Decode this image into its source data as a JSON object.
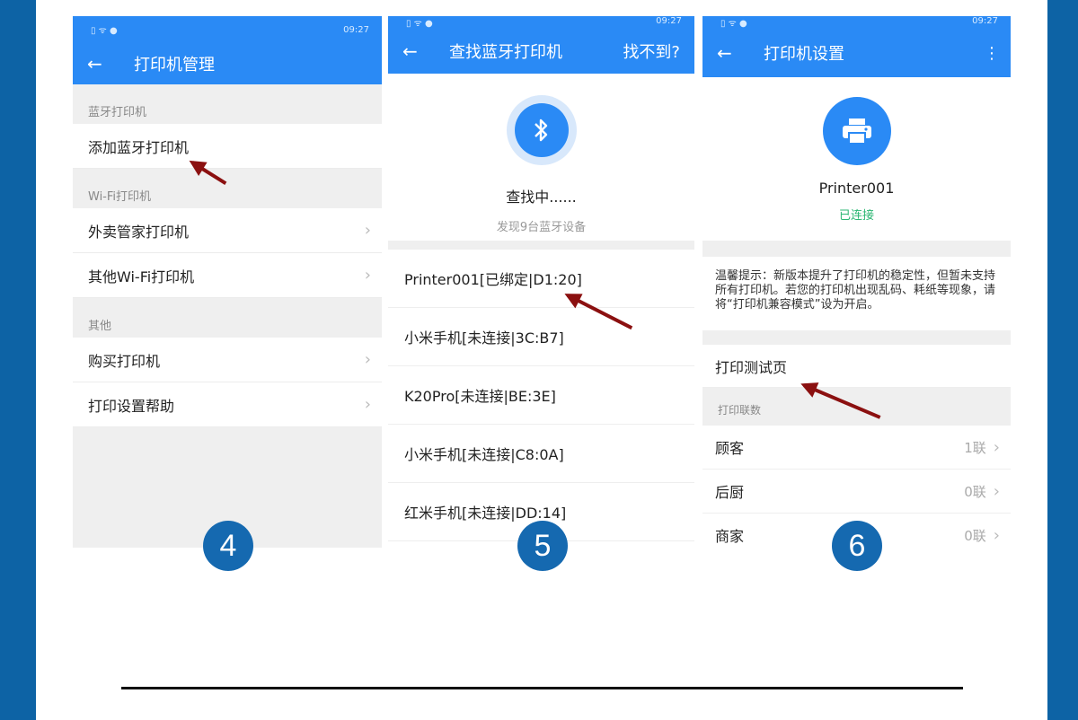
{
  "colors": {
    "accent": "#2a8af5",
    "frame": "#0d63a5",
    "arrow": "#8b1010",
    "badge": "#1569b0",
    "connected": "#2bb673"
  },
  "status": {
    "time": "09:27"
  },
  "screen1": {
    "title": "打印机管理",
    "back_icon": "←",
    "sections": [
      {
        "header": "蓝牙打印机",
        "items": [
          {
            "label": "添加蓝牙打印机"
          }
        ]
      },
      {
        "header": "Wi-Fi打印机",
        "items": [
          {
            "label": "外卖管家打印机"
          },
          {
            "label": "其他Wi-Fi打印机"
          }
        ]
      },
      {
        "header": "其他",
        "items": [
          {
            "label": "购买打印机"
          },
          {
            "label": "打印设置帮助"
          }
        ]
      }
    ],
    "step": "4"
  },
  "screen2": {
    "title": "查找蓝牙打印机",
    "back_icon": "←",
    "right_action": "找不到?",
    "searching": "查找中......",
    "found": "发现9台蓝牙设备",
    "devices": [
      "Printer001[已绑定|D1:20]",
      "小米手机[未连接|3C:B7]",
      "K20Pro[未连接|BE:3E]",
      "小米手机[未连接|C8:0A]",
      "红米手机[未连接|DD:14]"
    ],
    "step": "5"
  },
  "screen3": {
    "title": "打印机设置",
    "back_icon": "←",
    "menu_icon": "⋮",
    "printer_name": "Printer001",
    "printer_status": "已连接",
    "tip": "温馨提示：新版本提升了打印机的稳定性，但暂未支持所有打印机。若您的打印机出现乱码、耗纸等现象，请将“打印机兼容模式”设为开启。",
    "test_page": "打印测试页",
    "copies_header": "打印联数",
    "copies": [
      {
        "label": "顾客",
        "value": "1联"
      },
      {
        "label": "后厨",
        "value": "0联"
      },
      {
        "label": "商家",
        "value": "0联"
      }
    ],
    "step": "6"
  }
}
